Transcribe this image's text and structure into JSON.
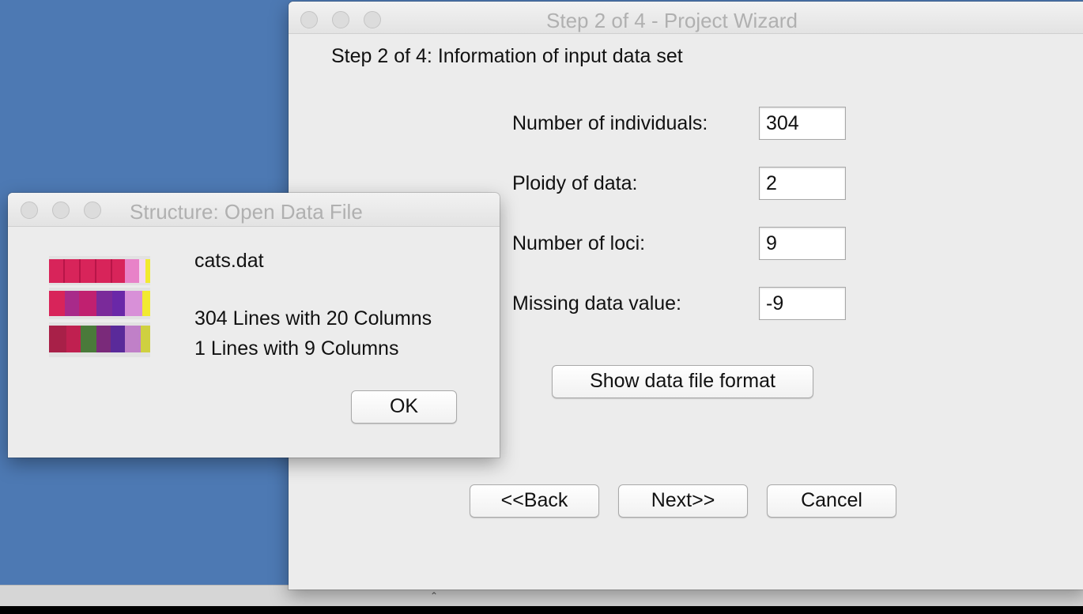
{
  "wizard": {
    "title": "Step 2 of 4 - Project Wizard",
    "heading": "Step 2 of 4: Information of input data set",
    "fields": [
      {
        "label": "Number of individuals:",
        "value": "304"
      },
      {
        "label": "Ploidy of data:",
        "value": "2"
      },
      {
        "label": "Number of loci:",
        "value": "9"
      },
      {
        "label": "Missing data value:",
        "value": "-9"
      }
    ],
    "show_format_label": "Show data file format",
    "back_label": "<<Back",
    "next_label": "Next>>",
    "cancel_label": "Cancel"
  },
  "dialog": {
    "title": "Structure: Open Data File",
    "filename": "cats.dat",
    "line1": "304 Lines with 20 Columns",
    "line2": "1 Lines with 9 Columns",
    "ok_label": "OK",
    "icon": "data-file-icon"
  }
}
